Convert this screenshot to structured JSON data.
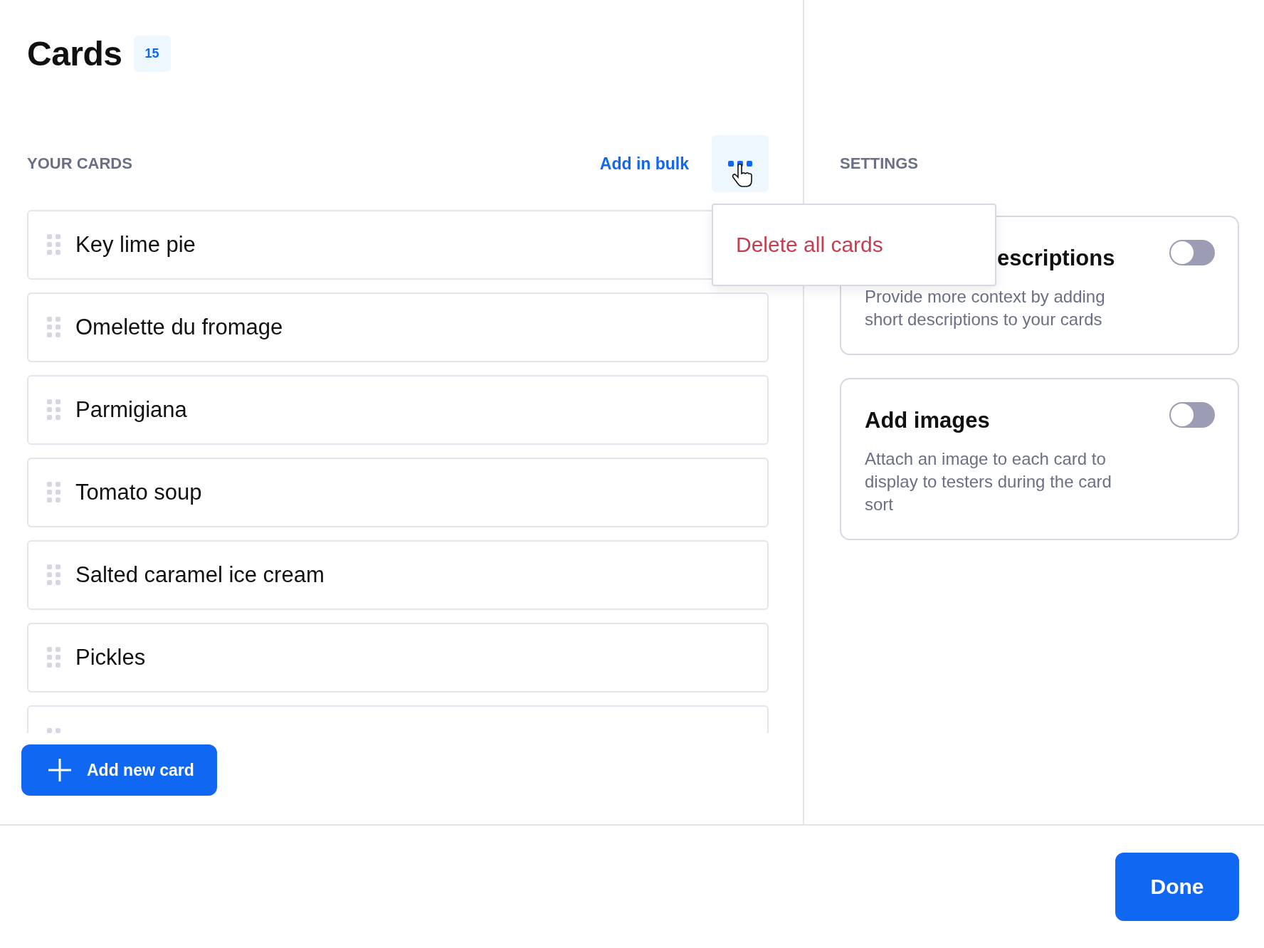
{
  "header": {
    "title": "Cards",
    "count": "15"
  },
  "cards_section": {
    "heading": "YOUR CARDS",
    "bulk_link": "Add in bulk",
    "menu_open": true,
    "menu": [
      {
        "label": "Delete all cards",
        "kind": "danger"
      }
    ],
    "cards": [
      {
        "label": "Key lime pie"
      },
      {
        "label": "Omelette du fromage"
      },
      {
        "label": "Parmigiana"
      },
      {
        "label": "Tomato soup"
      },
      {
        "label": "Salted caramel ice cream"
      },
      {
        "label": "Pickles"
      }
    ],
    "more_below": true,
    "add_button": "Add new card"
  },
  "settings": {
    "heading": "SETTINGS",
    "items": [
      {
        "title": "escriptions",
        "covered_by_menu": true,
        "description": "Provide more context by adding short descriptions to your cards",
        "on": false
      },
      {
        "title": "Add images",
        "covered_by_menu": false,
        "description": "Attach an image to each card to display to testers during the card sort",
        "on": false
      }
    ]
  },
  "footer": {
    "done_button": "Done"
  }
}
